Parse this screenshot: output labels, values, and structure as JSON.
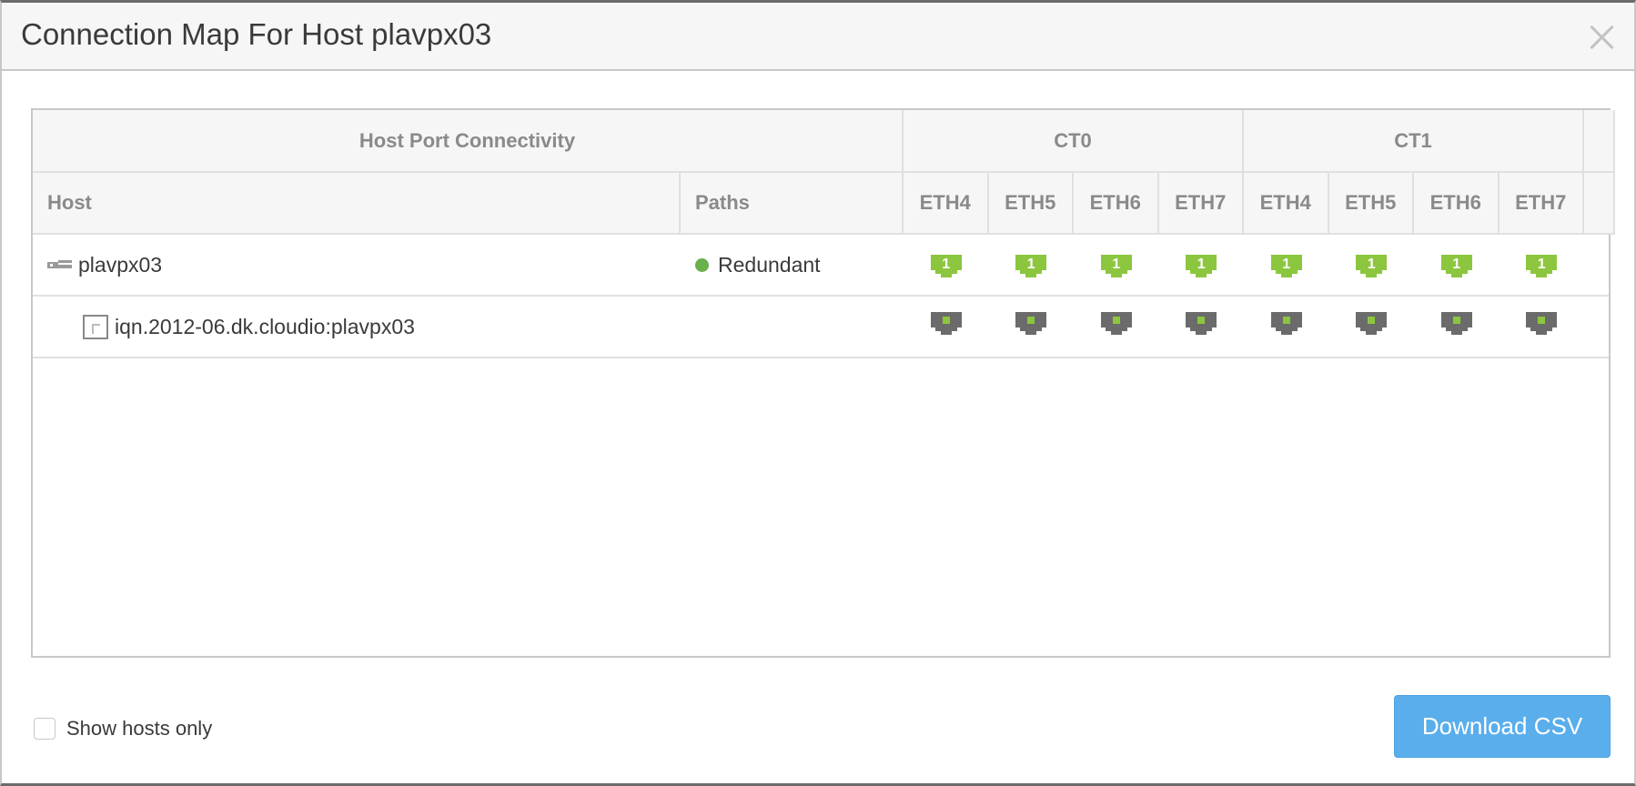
{
  "dialog": {
    "title": "Connection Map For Host plavpx03",
    "close_icon": "close-icon"
  },
  "table": {
    "group_headers": {
      "host_port_connectivity": "Host Port Connectivity",
      "ct0": "CT0",
      "ct1": "CT1"
    },
    "column_headers": {
      "host": "Host",
      "paths": "Paths",
      "ct0_ports": [
        "ETH4",
        "ETH5",
        "ETH6",
        "ETH7"
      ],
      "ct1_ports": [
        "ETH4",
        "ETH5",
        "ETH6",
        "ETH7"
      ]
    },
    "rows": [
      {
        "type": "host",
        "icon": "host-icon",
        "name": "plavpx03",
        "paths": "Redundant",
        "paths_status_color": "#6ab04c",
        "ports": [
          {
            "label": "1",
            "state": "connected"
          },
          {
            "label": "1",
            "state": "connected"
          },
          {
            "label": "1",
            "state": "connected"
          },
          {
            "label": "1",
            "state": "connected"
          },
          {
            "label": "1",
            "state": "connected"
          },
          {
            "label": "1",
            "state": "connected"
          },
          {
            "label": "1",
            "state": "connected"
          },
          {
            "label": "1",
            "state": "connected"
          }
        ]
      },
      {
        "type": "initiator",
        "icon": "iqn-icon",
        "name": "iqn.2012-06.dk.cloudio:plavpx03",
        "paths": "",
        "ports": [
          {
            "label": "",
            "state": "initiator-connected"
          },
          {
            "label": "",
            "state": "initiator-connected"
          },
          {
            "label": "",
            "state": "initiator-connected"
          },
          {
            "label": "",
            "state": "initiator-connected"
          },
          {
            "label": "",
            "state": "initiator-connected"
          },
          {
            "label": "",
            "state": "initiator-connected"
          },
          {
            "label": "",
            "state": "initiator-connected"
          },
          {
            "label": "",
            "state": "initiator-connected"
          }
        ]
      }
    ]
  },
  "colors": {
    "port_green": "#8cc63f",
    "port_gray": "#6b6b6b",
    "led_green": "#8cc63f",
    "button_blue": "#5aaeec"
  },
  "footer": {
    "show_hosts_only_label": "Show hosts only",
    "show_hosts_only_checked": false,
    "download_label": "Download CSV"
  }
}
